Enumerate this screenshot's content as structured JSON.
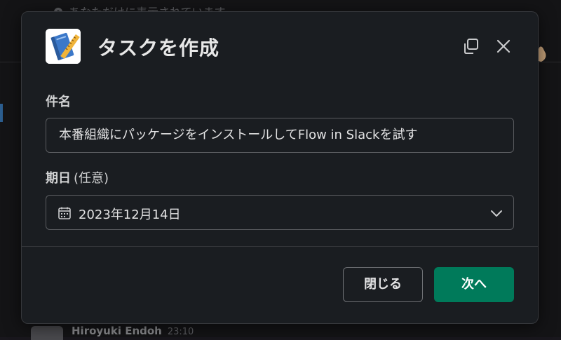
{
  "background": {
    "ephemeral_notice": "あなただけに表示されています",
    "message_author": "Hiroyuki Endoh",
    "message_time": "23:10"
  },
  "modal": {
    "title": "タスクを作成",
    "app_icon": "notebook-ruler-icon",
    "header_buttons": {
      "copy_icon": "copy-icon",
      "close_icon": "close-icon"
    }
  },
  "form": {
    "subject": {
      "label": "件名",
      "value": "本番組織にパッケージをインストールしてFlow in Slackを試す"
    },
    "due_date": {
      "label": "期日",
      "optional_label": "(任意)",
      "value": "2023年12月14日",
      "icon": "calendar-icon"
    }
  },
  "footer": {
    "close_label": "閉じる",
    "next_label": "次へ"
  },
  "colors": {
    "modal_bg": "#1a1d21",
    "primary_button": "#007a5a",
    "border": "#5a5c60"
  }
}
